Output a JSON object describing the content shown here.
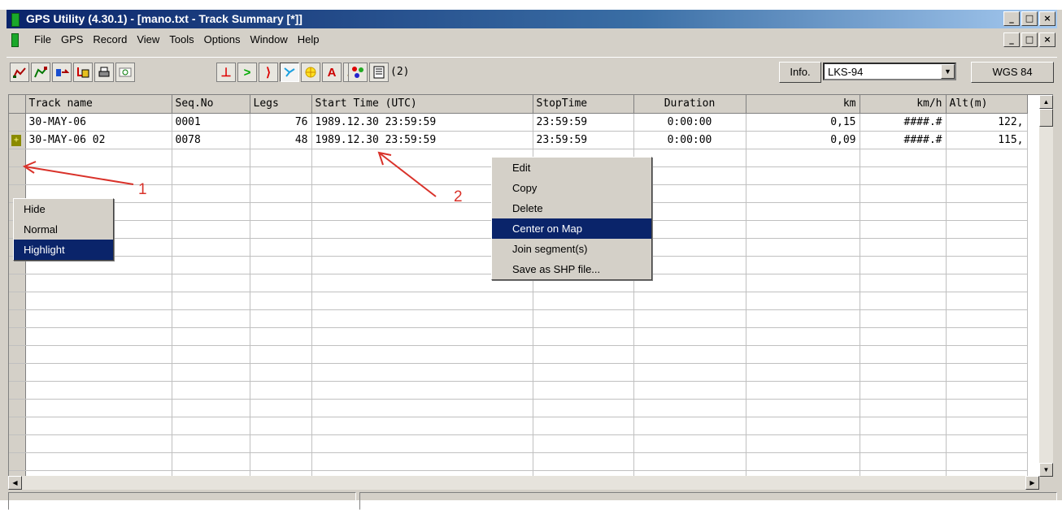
{
  "window": {
    "title": "GPS Utility (4.30.1) - [mano.txt - Track Summary [*]]",
    "caption_buttons": [
      "_",
      "□",
      "×"
    ],
    "mdi_buttons": [
      "_",
      "□",
      "×"
    ]
  },
  "menu": {
    "items": [
      "File",
      "GPS",
      "Record",
      "View",
      "Tools",
      "Options",
      "Window",
      "Help"
    ]
  },
  "toolbar": {
    "icons": [
      "track-icon",
      "route-icon",
      "transfer-icon",
      "export-icon",
      "print-icon",
      "map-settings-icon",
      "waypoint-icon",
      "route-arrow-icon",
      "track-arrow-icon",
      "track-toggle-icon",
      "crosshair-icon",
      "font-icon",
      "polygon-icon",
      "colors-icon",
      "list-icon"
    ],
    "count": "(2)",
    "info_label": "Info.",
    "datum": "LKS-94",
    "coords_label": "WGS 84"
  },
  "grid": {
    "columns": [
      "Track name",
      "Seq.No",
      "Legs",
      "Start Time (UTC)",
      "StopTime",
      "Duration",
      "km",
      "km/h",
      "Alt(m)"
    ],
    "rows": [
      {
        "marker": "",
        "name": "30-MAY-06",
        "seq": "0001",
        "legs": "76",
        "start": "1989.12.30 23:59:59",
        "stop": "23:59:59",
        "duration": "0:00:00",
        "km": "0,15",
        "kmh": "####.#",
        "alt": "122,"
      },
      {
        "marker": "+",
        "name": "30-MAY-06 02",
        "seq": "0078",
        "legs": "48",
        "start": "1989.12.30 23:59:59",
        "stop": "23:59:59",
        "duration": "0:00:00",
        "km": "0,09",
        "kmh": "####.#",
        "alt": "115,"
      }
    ]
  },
  "display_menu": {
    "items": [
      "Hide",
      "Normal",
      "Highlight"
    ],
    "selected": "Highlight"
  },
  "context_menu": {
    "items": [
      "Edit",
      "Copy",
      "Delete",
      "Center on Map",
      "Join segment(s)",
      "Save as SHP file..."
    ],
    "selected": "Center on Map"
  },
  "annotations": {
    "label_1": "1",
    "label_2": "2",
    "color": "#d9322a"
  }
}
